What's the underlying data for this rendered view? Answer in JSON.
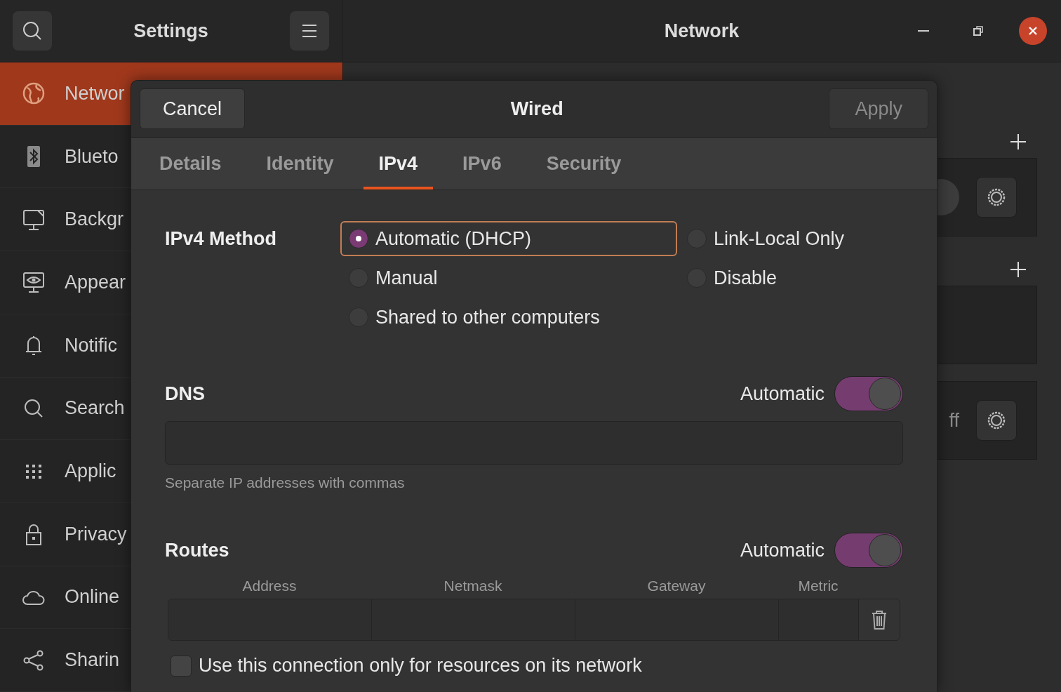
{
  "app": {
    "title": "Settings"
  },
  "sidebar": {
    "items": [
      {
        "label": "Networ",
        "selected": true
      },
      {
        "label": "Blueto",
        "selected": false
      },
      {
        "label": "Backgr",
        "selected": false
      },
      {
        "label": "Appear",
        "selected": false
      },
      {
        "label": "Notific",
        "selected": false
      },
      {
        "label": "Search",
        "selected": false
      },
      {
        "label": "Applic",
        "selected": false
      },
      {
        "label": "Privacy",
        "selected": false
      },
      {
        "label": "Online",
        "selected": false
      },
      {
        "label": "Sharin",
        "selected": false
      }
    ]
  },
  "main": {
    "title": "Network",
    "status_text": "ff"
  },
  "dialog": {
    "title": "Wired",
    "cancel": "Cancel",
    "apply": {
      "label": "Apply",
      "disabled": true
    },
    "tabs": [
      {
        "label": "Details",
        "selected": false
      },
      {
        "label": "Identity",
        "selected": false
      },
      {
        "label": "IPv4",
        "selected": true
      },
      {
        "label": "IPv6",
        "selected": false
      },
      {
        "label": "Security",
        "selected": false
      }
    ],
    "ipv4_method": {
      "label": "IPv4 Method",
      "options": [
        {
          "label": "Automatic (DHCP)",
          "selected": true
        },
        {
          "label": "Link-Local Only",
          "selected": false
        },
        {
          "label": "Manual",
          "selected": false
        },
        {
          "label": "Disable",
          "selected": false
        },
        {
          "label": "Shared to other computers",
          "selected": false
        }
      ]
    },
    "dns": {
      "label": "DNS",
      "automatic_label": "Automatic",
      "automatic": true,
      "hint": "Separate IP addresses with commas"
    },
    "routes": {
      "label": "Routes",
      "automatic_label": "Automatic",
      "automatic": true,
      "columns": [
        "Address",
        "Netmask",
        "Gateway",
        "Metric"
      ]
    },
    "only_local": {
      "label": "Use this connection only for resources on its network",
      "checked": false
    }
  }
}
